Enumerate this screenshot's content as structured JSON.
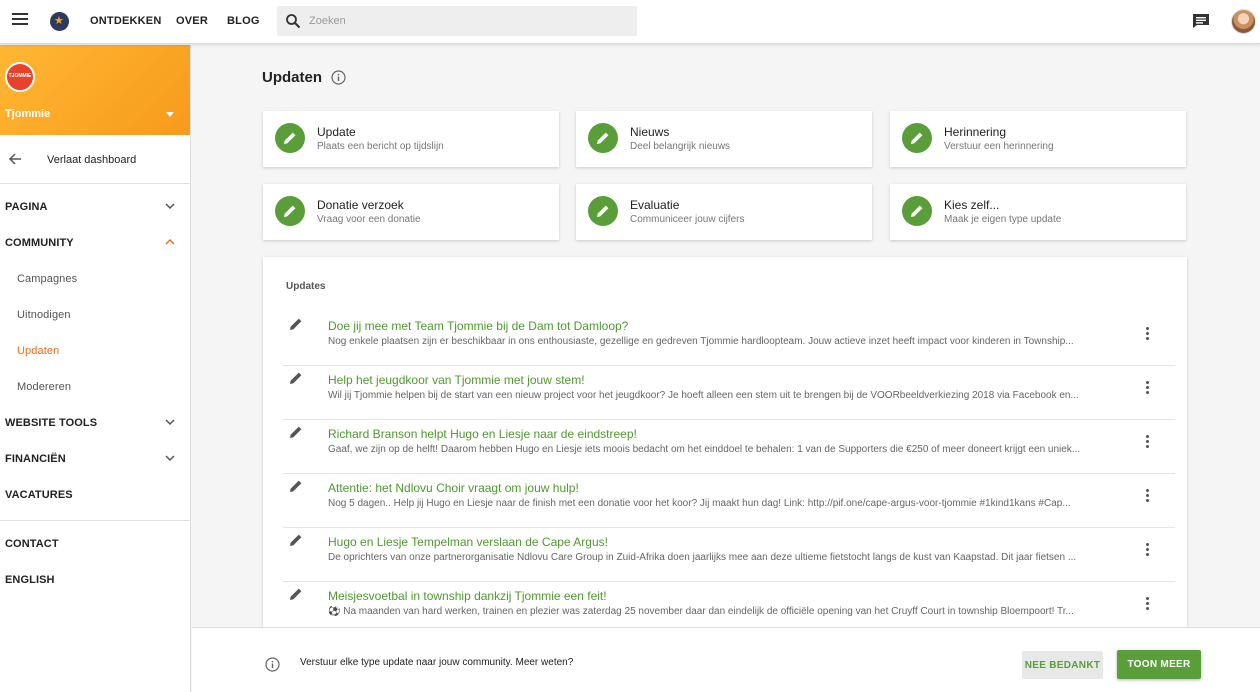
{
  "topbar": {
    "nav": [
      "ONTDEKKEN",
      "OVER",
      "BLOG"
    ],
    "search_placeholder": "Zoeken",
    "icons": [
      "menu-icon",
      "logo-icon",
      "search-icon",
      "chat-icon",
      "avatar"
    ]
  },
  "sidebar": {
    "org_name": "Tjommie",
    "org_logo_text": "TJOMMIE",
    "leave_label": "Verlaat dashboard",
    "items": [
      {
        "label": "PAGINA",
        "type": "section",
        "expanded": false
      },
      {
        "label": "COMMUNITY",
        "type": "section",
        "expanded": true
      },
      {
        "label": "Campagnes",
        "type": "sub"
      },
      {
        "label": "Uitnodigen",
        "type": "sub"
      },
      {
        "label": "Updaten",
        "type": "sub",
        "active": true
      },
      {
        "label": "Modereren",
        "type": "sub"
      },
      {
        "label": "WEBSITE TOOLS",
        "type": "section",
        "expanded": false
      },
      {
        "label": "FINANCIËN",
        "type": "section",
        "expanded": false
      },
      {
        "label": "VACATURES",
        "type": "section"
      },
      {
        "label": "CONTACT",
        "type": "section"
      },
      {
        "label": "ENGLISH",
        "type": "section"
      }
    ]
  },
  "main": {
    "title": "Updaten",
    "cards": [
      {
        "title": "Update",
        "subtitle": "Plaats een bericht op tijdslijn"
      },
      {
        "title": "Nieuws",
        "subtitle": "Deel belangrijk nieuws"
      },
      {
        "title": "Herinnering",
        "subtitle": "Verstuur een herinnering"
      },
      {
        "title": "Donatie verzoek",
        "subtitle": "Vraag voor een donatie"
      },
      {
        "title": "Evaluatie",
        "subtitle": "Communiceer jouw cijfers"
      },
      {
        "title": "Kies zelf...",
        "subtitle": "Maak je eigen type update"
      }
    ],
    "updates_heading": "Updates",
    "updates": [
      {
        "title": "Doe jij mee met Team Tjommie bij de Dam tot Damloop?",
        "text": "Nog enkele plaatsen zijn er beschikbaar in ons enthousiaste, gezellige en gedreven Tjommie hardloopteam. Jouw actieve inzet heeft impact voor kinderen in Township..."
      },
      {
        "title": "Help het jeugdkoor van Tjommie met jouw stem!",
        "text": "Wil jij Tjommie helpen bij de start van een nieuw project voor het jeugdkoor? Je hoeft alleen een stem uit te  brengen bij de VOORbeeldverkiezing 2018 via Facebook en..."
      },
      {
        "title": "Richard Branson helpt Hugo en Liesje naar de eindstreep!",
        "text": "Gaaf, we zijn op de helft! Daarom hebben Hugo en Liesje iets moois bedacht om het einddoel te behalen: 1 van de Supporters die €250 of meer doneert krijgt een uniek..."
      },
      {
        "title": "Attentie: het Ndlovu Choir vraagt om jouw hulp!",
        "text": "Nog 5 dagen.. Help jij Hugo en Liesje naar de finish met een donatie voor het koor? Jij maakt hun dag! Link: http://pif.one/cape-argus-voor-tjommie #1kind1kans #Cap..."
      },
      {
        "title": "Hugo en Liesje Tempelman verslaan de Cape Argus!",
        "text": "De oprichters van onze partnerorganisatie Ndlovu Care Group in Zuid-Afrika doen jaarlijks mee aan deze ultieme fietstocht langs de kust van Kaapstad. Dit jaar fietsen ..."
      },
      {
        "title": "Meisjesvoetbal in township dankzij Tjommie een feit!",
        "text": "⚽ Na maanden van hard werken, trainen en plezier was zaterdag 25 november daar dan eindelijk de officiële opening van het Cruyff Court in township Bloempoort! Tr..."
      }
    ]
  },
  "bottom": {
    "text": "Verstuur elke type update naar jouw community. Meer weten?",
    "no_thanks": "NEE BEDANKT",
    "show_more": "TOON MEER"
  },
  "colors": {
    "accent_green": "#5a9e3a",
    "link_green": "#4e9a2e",
    "orange": "#f89a1c",
    "active_orange": "#f26b21"
  }
}
